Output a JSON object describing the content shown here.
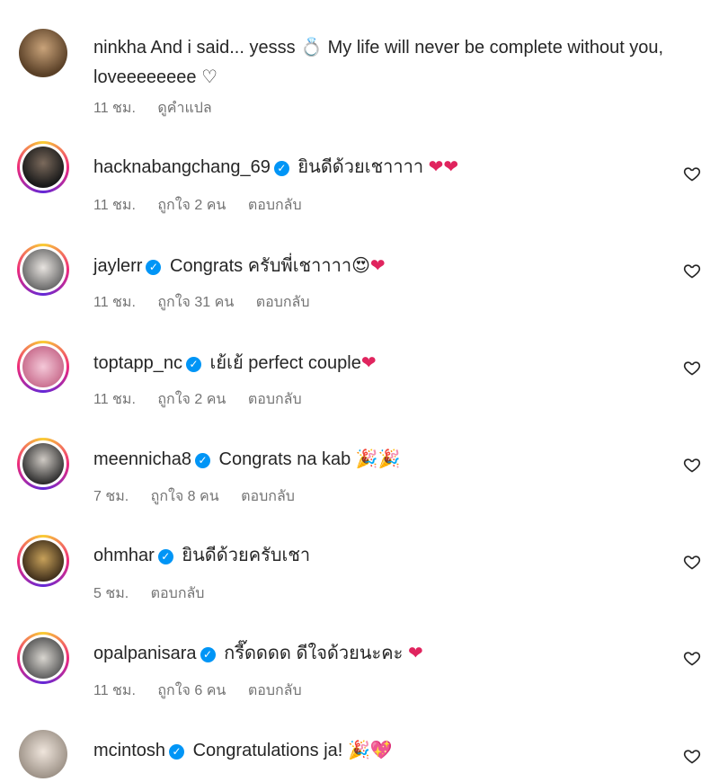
{
  "comments": [
    {
      "username": "ninkha",
      "verified": false,
      "text": "And i said... yesss",
      "emoji1": "💍",
      "text2": "My life will never be complete without you, loveeeeeeee",
      "emoji2": "♡",
      "time": "11 ชม.",
      "translate": "ดูคำแปล"
    },
    {
      "username": "hacknabangchang_69",
      "verified": true,
      "text": "ยินดีด้วยเชาาาา",
      "emoji1": "❤❤",
      "time": "11 ชม.",
      "likes": "ถูกใจ 2 คน",
      "reply": "ตอบกลับ"
    },
    {
      "username": "jaylerr",
      "verified": true,
      "text": "Congrats ครับพี่เชาาาา",
      "emoji1": "😍",
      "emoji2": "❤",
      "time": "11 ชม.",
      "likes": "ถูกใจ 31 คน",
      "reply": "ตอบกลับ"
    },
    {
      "username": "toptapp_nc",
      "verified": true,
      "text": "เย้เย้ perfect couple",
      "emoji1": "❤",
      "time": "11 ชม.",
      "likes": "ถูกใจ 2 คน",
      "reply": "ตอบกลับ"
    },
    {
      "username": "meennicha8",
      "verified": true,
      "text": "Congrats na kab",
      "emoji1": "🎉🎉",
      "time": "7 ชม.",
      "likes": "ถูกใจ 8 คน",
      "reply": "ตอบกลับ"
    },
    {
      "username": "ohmhar",
      "verified": true,
      "text": "ยินดีด้วยครับเชา",
      "time": "5 ชม.",
      "reply": "ตอบกลับ"
    },
    {
      "username": "opalpanisara",
      "verified": true,
      "text": "กรี๊ดดดด ดีใจด้วยนะคะ",
      "emoji1": "❤",
      "time": "11 ชม.",
      "likes": "ถูกใจ 6 คน",
      "reply": "ตอบกลับ"
    },
    {
      "username": "mcintosh",
      "verified": true,
      "text": "Congratulations ja!",
      "emoji1": "🎉💖"
    }
  ],
  "icons": {
    "verified": "verified-badge-icon",
    "like": "heart-outline-icon"
  },
  "colors": {
    "meta": "#737373",
    "verified": "#0095f6",
    "heart": "#e0245e"
  }
}
